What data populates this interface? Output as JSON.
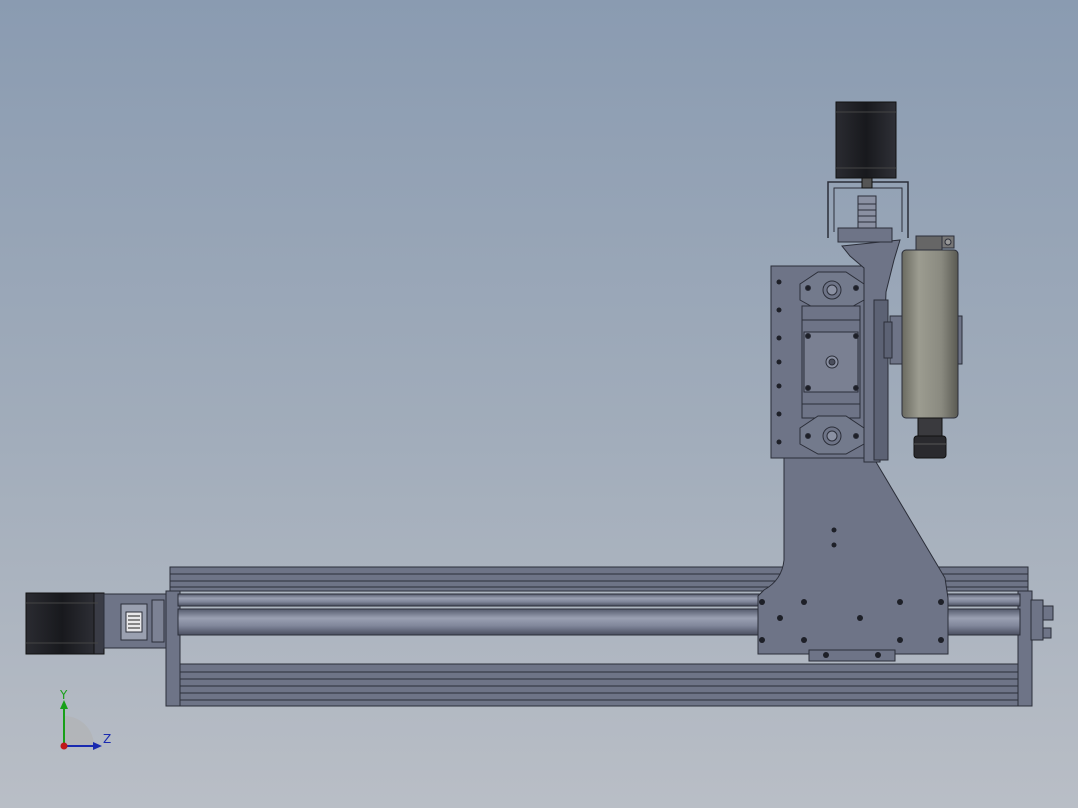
{
  "view": {
    "background_top": "#8a9bb1",
    "background_bottom": "#b9bec6"
  },
  "model": {
    "part_color": "#6e7487",
    "part_edge_color": "#2b2e39",
    "motor_color": "#1e1f24",
    "spindle_color": "#84847a"
  },
  "triad": {
    "y_label": "Y",
    "z_label": "Z",
    "y_color": "#18a018",
    "z_color": "#1a2ab0",
    "x_color": "#c01818"
  }
}
